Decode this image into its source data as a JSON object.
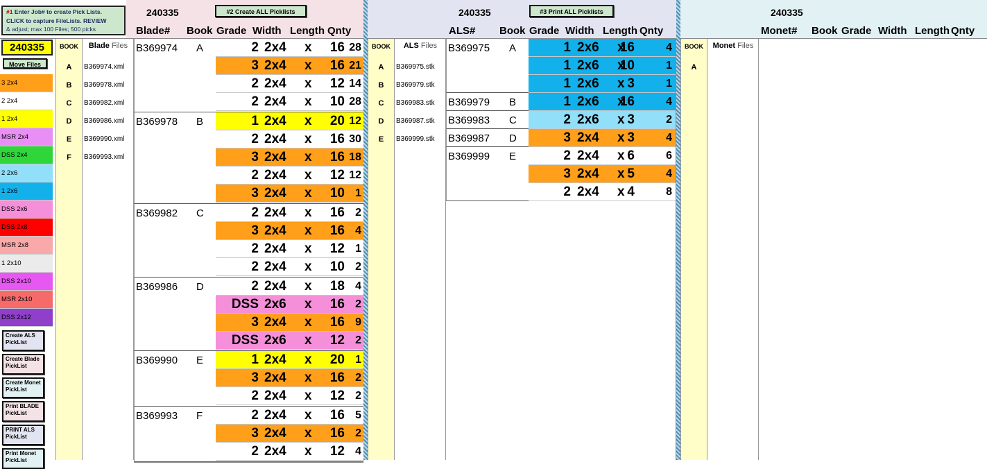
{
  "instructions": {
    "line1a": "#1",
    "line1b": " Enter Job# to create Pick Lists.",
    "line2": "CLICK to capture FileLists. REVIEW",
    "line3": "& adjust; max 100 Files; 500 picks"
  },
  "job_number": "240335",
  "move_files": "Move Files",
  "create_all": "#2 Create ALL Picklists",
  "print_all": "#3 Print ALL Picklists",
  "legend": [
    {
      "label": "3 2x4",
      "color": "#ff9f1a"
    },
    {
      "label": "2 2x4",
      "color": "#ffffff"
    },
    {
      "label": "1 2x4",
      "color": "#ffff00"
    },
    {
      "label": "MSR 2x4",
      "color": "#e98ef5"
    },
    {
      "label": "DSS 2x4",
      "color": "#2ed63a"
    },
    {
      "label": "2 2x6",
      "color": "#92dffa"
    },
    {
      "label": "1 2x6",
      "color": "#12b1ec"
    },
    {
      "label": "DSS 2x6",
      "color": "#f58fd9"
    },
    {
      "label": "DSS 2x8",
      "color": "#ff0000"
    },
    {
      "label": "MSR 2x8",
      "color": "#f9a9a9"
    },
    {
      "label": "1 2x10",
      "color": "#ebebeb"
    },
    {
      "label": "DSS 2x10",
      "color": "#e757f2"
    },
    {
      "label": "MSR 2x10",
      "color": "#f76a6a"
    },
    {
      "label": "DSS 2x12",
      "color": "#8f3fca"
    }
  ],
  "side_buttons": [
    {
      "label": "Create  ALS PickList",
      "bg": "#e2e5f1"
    },
    {
      "label": "Create Blade PickList",
      "bg": "#f4e2e6"
    },
    {
      "label": "Create Monet PickList",
      "bg": "#e1f1f4"
    },
    {
      "label": "Print BLADE PickList",
      "bg": "#f4e2e6"
    },
    {
      "label": "PRINT ALS PickList",
      "bg": "#e2e5f1"
    },
    {
      "label": "Print Monet PickList",
      "bg": "#e1f1f4"
    }
  ],
  "book_hdr": "BOOK",
  "blade": {
    "files_label": "Blade",
    "files_suffix": "Files",
    "headers": {
      "id": "Blade#",
      "book": "Book",
      "grade": "Grade",
      "width": "Width",
      "length": "Length",
      "qnty": "Qnty"
    },
    "files": [
      {
        "book": "A",
        "file": "B369974.xml"
      },
      {
        "book": "B",
        "file": "B369978.xml"
      },
      {
        "book": "C",
        "file": "B369982.xml"
      },
      {
        "book": "D",
        "file": "B369986.xml"
      },
      {
        "book": "E",
        "file": "B369990.xml"
      },
      {
        "book": "F",
        "file": "B369993.xml"
      }
    ],
    "groups": [
      {
        "id": "B369974",
        "book": "A",
        "rows": [
          [
            "2",
            "2x4",
            "16",
            "28",
            "#ffffff"
          ],
          [
            "3",
            "2x4",
            "16",
            "21",
            "#ff9f1a"
          ],
          [
            "2",
            "2x4",
            "12",
            "14",
            "#ffffff"
          ],
          [
            "2",
            "2x4",
            "10",
            "28",
            "#ffffff"
          ]
        ]
      },
      {
        "id": "B369978",
        "book": "B",
        "rows": [
          [
            "1",
            "2x4",
            "20",
            "12",
            "#ffff00"
          ],
          [
            "2",
            "2x4",
            "16",
            "30",
            "#ffffff"
          ],
          [
            "3",
            "2x4",
            "16",
            "18",
            "#ff9f1a"
          ],
          [
            "2",
            "2x4",
            "12",
            "12",
            "#ffffff"
          ],
          [
            "3",
            "2x4",
            "10",
            "1",
            "#ff9f1a"
          ]
        ]
      },
      {
        "id": "B369982",
        "book": "C",
        "rows": [
          [
            "2",
            "2x4",
            "16",
            "2",
            "#ffffff"
          ],
          [
            "3",
            "2x4",
            "16",
            "4",
            "#ff9f1a"
          ],
          [
            "2",
            "2x4",
            "12",
            "1",
            "#ffffff"
          ],
          [
            "2",
            "2x4",
            "10",
            "2",
            "#ffffff"
          ]
        ]
      },
      {
        "id": "B369986",
        "book": "D",
        "rows": [
          [
            "2",
            "2x4",
            "18",
            "4",
            "#ffffff"
          ],
          [
            "DSS",
            "2x6",
            "16",
            "2",
            "#f58fd9"
          ],
          [
            "3",
            "2x4",
            "16",
            "9",
            "#ff9f1a"
          ],
          [
            "DSS",
            "2x6",
            "12",
            "2",
            "#f58fd9"
          ]
        ]
      },
      {
        "id": "B369990",
        "book": "E",
        "rows": [
          [
            "1",
            "2x4",
            "20",
            "1",
            "#ffff00"
          ],
          [
            "3",
            "2x4",
            "16",
            "2",
            "#ff9f1a"
          ],
          [
            "2",
            "2x4",
            "12",
            "2",
            "#ffffff"
          ]
        ]
      },
      {
        "id": "B369993",
        "book": "F",
        "rows": [
          [
            "2",
            "2x4",
            "16",
            "5",
            "#ffffff"
          ],
          [
            "3",
            "2x4",
            "16",
            "2",
            "#ff9f1a"
          ],
          [
            "2",
            "2x4",
            "12",
            "4",
            "#ffffff"
          ]
        ]
      }
    ]
  },
  "als": {
    "files_label": "ALS",
    "files_suffix": "Files",
    "headers": {
      "id": "ALS#",
      "book": "Book",
      "grade": "Grade",
      "width": "Width",
      "length": "Length",
      "qnty": "Qnty"
    },
    "files": [
      {
        "book": "A",
        "file": "B369975.stk"
      },
      {
        "book": "B",
        "file": "B369979.stk"
      },
      {
        "book": "C",
        "file": "B369983.stk"
      },
      {
        "book": "D",
        "file": "B369987.stk"
      },
      {
        "book": "E",
        "file": "B369999.stk"
      }
    ],
    "groups": [
      {
        "id": "B369975",
        "book": "A",
        "rows": [
          [
            "1",
            "2x6",
            "16",
            "4",
            "#12b1ec"
          ],
          [
            "1",
            "2x6",
            "10",
            "1",
            "#12b1ec"
          ],
          [
            "1",
            "2x6",
            "3",
            "1",
            "#12b1ec"
          ]
        ]
      },
      {
        "id": "B369979",
        "book": "B",
        "rows": [
          [
            "1",
            "2x6",
            "16",
            "4",
            "#12b1ec"
          ]
        ]
      },
      {
        "id": "B369983",
        "book": "C",
        "rows": [
          [
            "2",
            "2x6",
            "3",
            "2",
            "#92dffa"
          ]
        ]
      },
      {
        "id": "B369987",
        "book": "D",
        "rows": [
          [
            "3",
            "2x4",
            "3",
            "4",
            "#ff9f1a"
          ]
        ]
      },
      {
        "id": "B369999",
        "book": "E",
        "rows": [
          [
            "2",
            "2x4",
            "6",
            "6",
            "#ffffff"
          ],
          [
            "3",
            "2x4",
            "5",
            "4",
            "#ff9f1a"
          ],
          [
            "2",
            "2x4",
            "4",
            "8",
            "#ffffff"
          ]
        ]
      }
    ]
  },
  "monet": {
    "files_label": "Monet",
    "files_suffix": "Files",
    "headers": {
      "id": "Monet#",
      "book": "Book",
      "grade": "Grade",
      "width": "Width",
      "length": "Length",
      "qnty": "Qnty"
    },
    "files": [
      {
        "book": "A",
        "file": ""
      }
    ]
  },
  "x_sep": "x"
}
